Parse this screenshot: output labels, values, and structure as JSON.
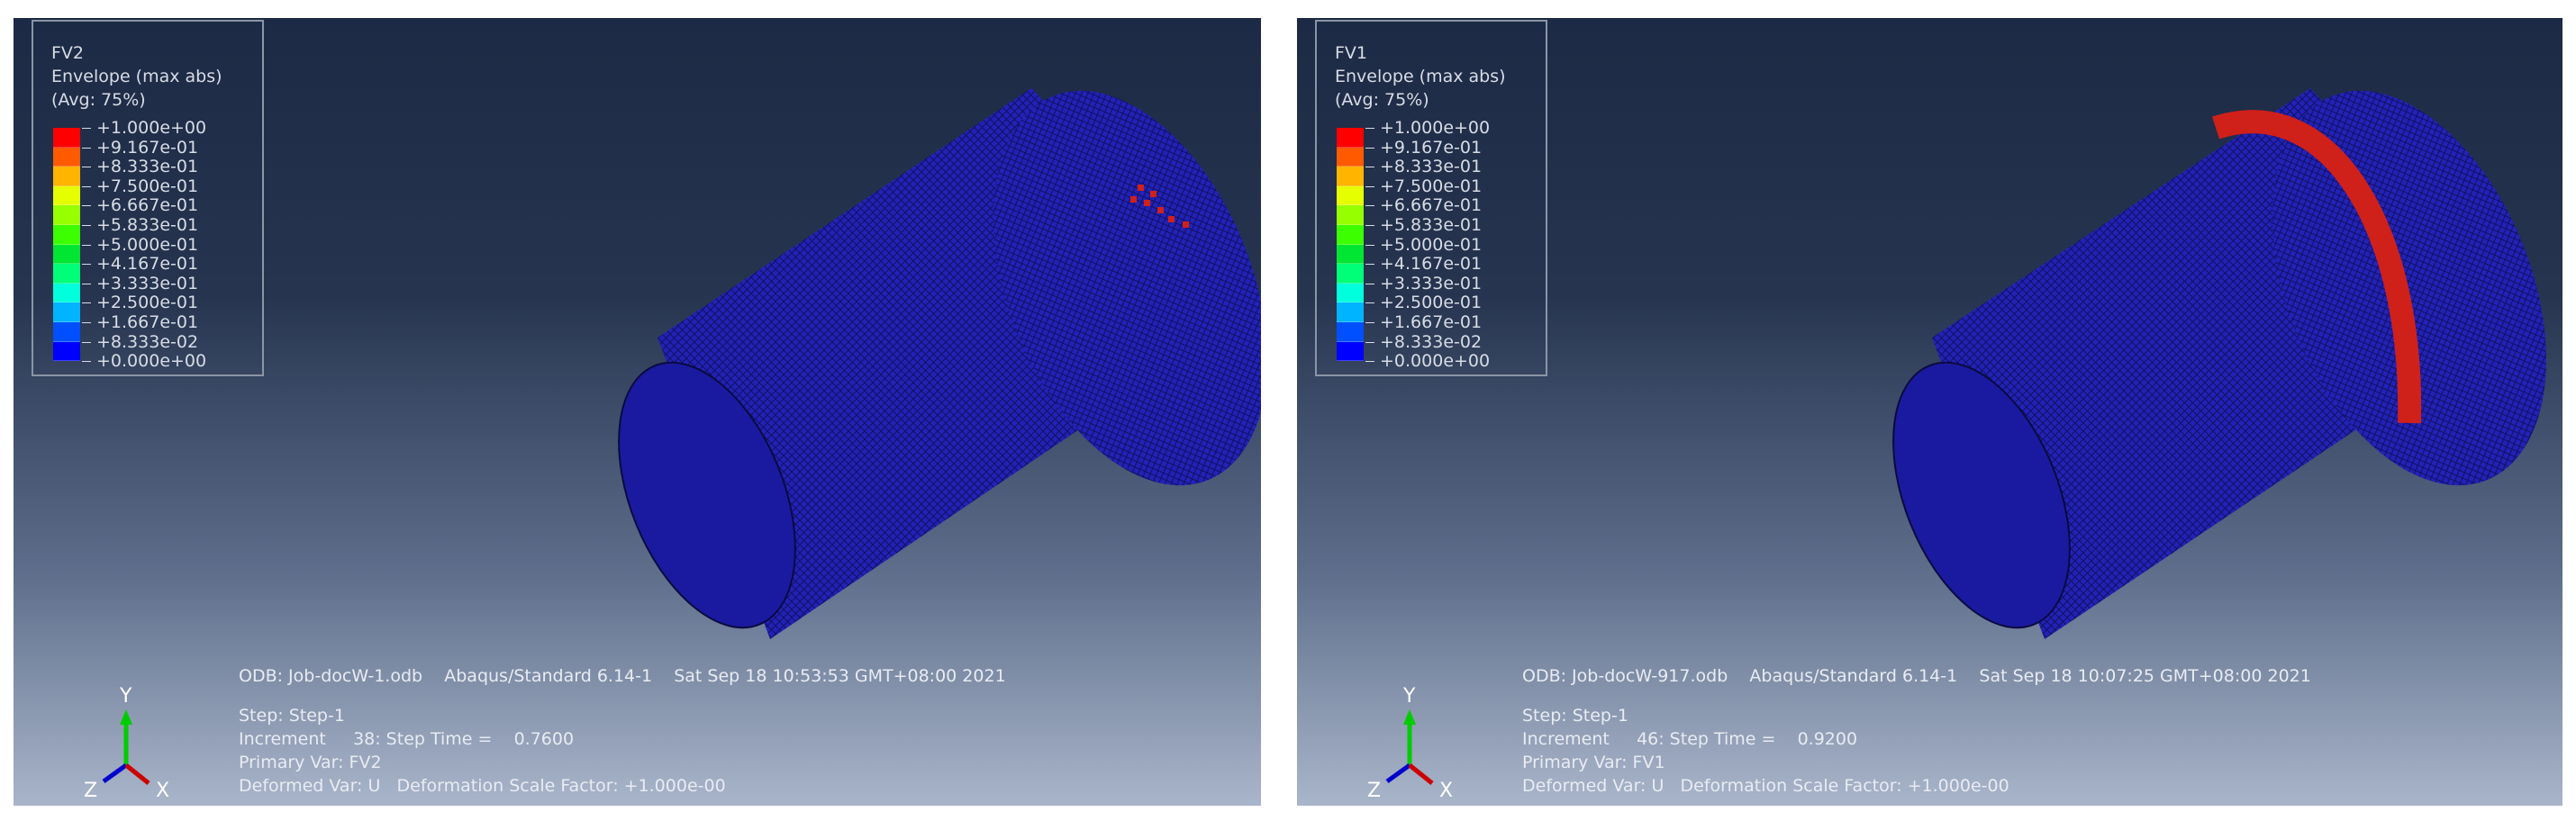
{
  "panels": [
    {
      "legend": {
        "title": "FV2",
        "subtitle": "Envelope (max abs)",
        "avg": "(Avg: 75%)"
      },
      "info": {
        "odb": "ODB: Job-docW-1.odb    Abaqus/Standard 6.14-1    Sat Sep 18 10:53:53 GMT+08:00 2021",
        "step": "Step: Step-1",
        "increment": "Increment     38: Step Time =    0.7600",
        "primary": "Primary Var: FV2",
        "deformed": "Deformed Var: U   Deformation Scale Factor: +1.000e-00"
      }
    },
    {
      "legend": {
        "title": "FV1",
        "subtitle": "Envelope (max abs)",
        "avg": "(Avg: 75%)"
      },
      "info": {
        "odb": "ODB: Job-docW-917.odb    Abaqus/Standard 6.14-1    Sat Sep 18 10:07:25 GMT+08:00 2021",
        "step": "Step: Step-1",
        "increment": "Increment     46: Step Time =    0.9200",
        "primary": "Primary Var: FV1",
        "deformed": "Deformed Var: U   Deformation Scale Factor: +1.000e-00"
      }
    }
  ],
  "legend_values": [
    "+1.000e+00",
    "+9.167e-01",
    "+8.333e-01",
    "+7.500e-01",
    "+6.667e-01",
    "+5.833e-01",
    "+5.000e-01",
    "+4.167e-01",
    "+3.333e-01",
    "+2.500e-01",
    "+1.667e-01",
    "+8.333e-02",
    "+0.000e+00"
  ],
  "legend_colors": [
    "#ff0000",
    "#ff5a00",
    "#ffb400",
    "#e6ff00",
    "#96ff00",
    "#3cff00",
    "#00e632",
    "#00ff78",
    "#00ffdc",
    "#00b4ff",
    "#0050ff",
    "#0000ff"
  ],
  "triad": {
    "x": "X",
    "y": "Y",
    "z": "Z"
  },
  "colors": {
    "mesh": "#1f1fb0",
    "failed": "#d0201a"
  }
}
